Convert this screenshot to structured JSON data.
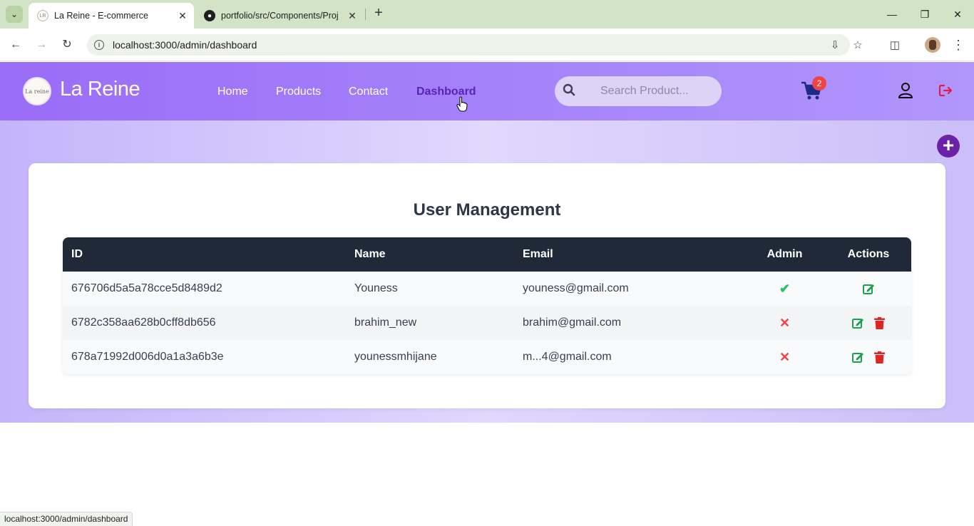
{
  "browser": {
    "tabs": [
      {
        "title": "La Reine - E-commerce",
        "favicon": "la-reine-logo-icon",
        "active": true
      },
      {
        "title": "portfolio/src/Components/Proj",
        "favicon": "github-icon",
        "active": false
      }
    ],
    "url": "localhost:3000/admin/dashboard",
    "status_url": "localhost:3000/admin/dashboard"
  },
  "site": {
    "logo_small_text": "La reine",
    "brand": "La Reine",
    "nav": [
      {
        "label": "Home",
        "active": false
      },
      {
        "label": "Products",
        "active": false
      },
      {
        "label": "Contact",
        "active": false
      },
      {
        "label": "Dashboard",
        "active": true
      }
    ],
    "search_placeholder": "Search Product...",
    "cart_count": "2",
    "accent_color": "#5b21b6",
    "header_color": "#9b6cf7"
  },
  "main": {
    "title": "User Management",
    "columns": {
      "id": "ID",
      "name": "Name",
      "email": "Email",
      "admin": "Admin",
      "actions": "Actions"
    },
    "rows": [
      {
        "id": "676706d5a5a78cce5d8489d2",
        "name": "Youness",
        "email": "youness@gmail.com",
        "admin": "✔",
        "is_admin": true
      },
      {
        "id": "6782c358aa628b0cff8db656",
        "name": "brahim_new",
        "email": "brahim@gmail.com",
        "admin": "✕",
        "is_admin": false
      },
      {
        "id": "678a71992d006d0a1a3a6b3e",
        "name": "younessmhijane",
        "email": "m...4@gmail.com",
        "admin": "✕",
        "is_admin": false
      }
    ],
    "add_button": "+"
  }
}
